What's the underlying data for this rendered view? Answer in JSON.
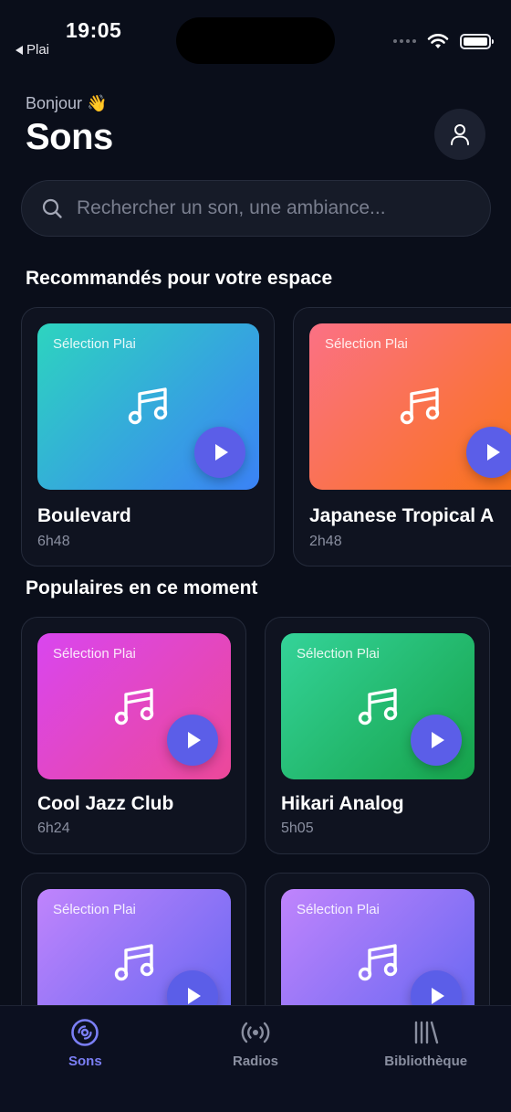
{
  "status_bar": {
    "time": "19:05",
    "back_label": "Plai"
  },
  "header": {
    "greeting": "Bonjour 👋",
    "title": "Sons"
  },
  "search": {
    "placeholder": "Rechercher un son, une ambiance..."
  },
  "sections": {
    "recommended": {
      "title": "Recommandés pour votre espace",
      "items": [
        {
          "badge": "Sélection Plai",
          "title": "Boulevard",
          "duration": "6h48",
          "gradient": [
            "#2dd4bf",
            "#3b82f6"
          ]
        },
        {
          "badge": "Sélection Plai",
          "title": "Japanese Tropical A",
          "duration": "2h48",
          "gradient": [
            "#fb7185",
            "#f97316"
          ]
        }
      ]
    },
    "popular": {
      "title": "Populaires en ce moment",
      "items": [
        {
          "badge": "Sélection Plai",
          "title": "Cool Jazz Club",
          "duration": "6h24",
          "gradient": [
            "#d946ef",
            "#ec4899"
          ]
        },
        {
          "badge": "Sélection Plai",
          "title": "Hikari Analog",
          "duration": "5h05",
          "gradient": [
            "#34d399",
            "#16a34a"
          ]
        },
        {
          "badge": "Sélection Plai",
          "gradient": [
            "#c084fc",
            "#6366f1"
          ]
        },
        {
          "badge": "Sélection Plai",
          "gradient": [
            "#c084fc",
            "#6366f1"
          ]
        }
      ]
    }
  },
  "tab_bar": {
    "items": [
      {
        "label": "Sons",
        "icon": "vinyl-icon",
        "active": true
      },
      {
        "label": "Radios",
        "icon": "radio-broadcast-icon",
        "active": false
      },
      {
        "label": "Bibliothèque",
        "icon": "library-icon",
        "active": false
      }
    ]
  },
  "colors": {
    "accent": "#7b7ff5",
    "play_button": "#5b5ee8",
    "background": "#0a0e1a"
  }
}
